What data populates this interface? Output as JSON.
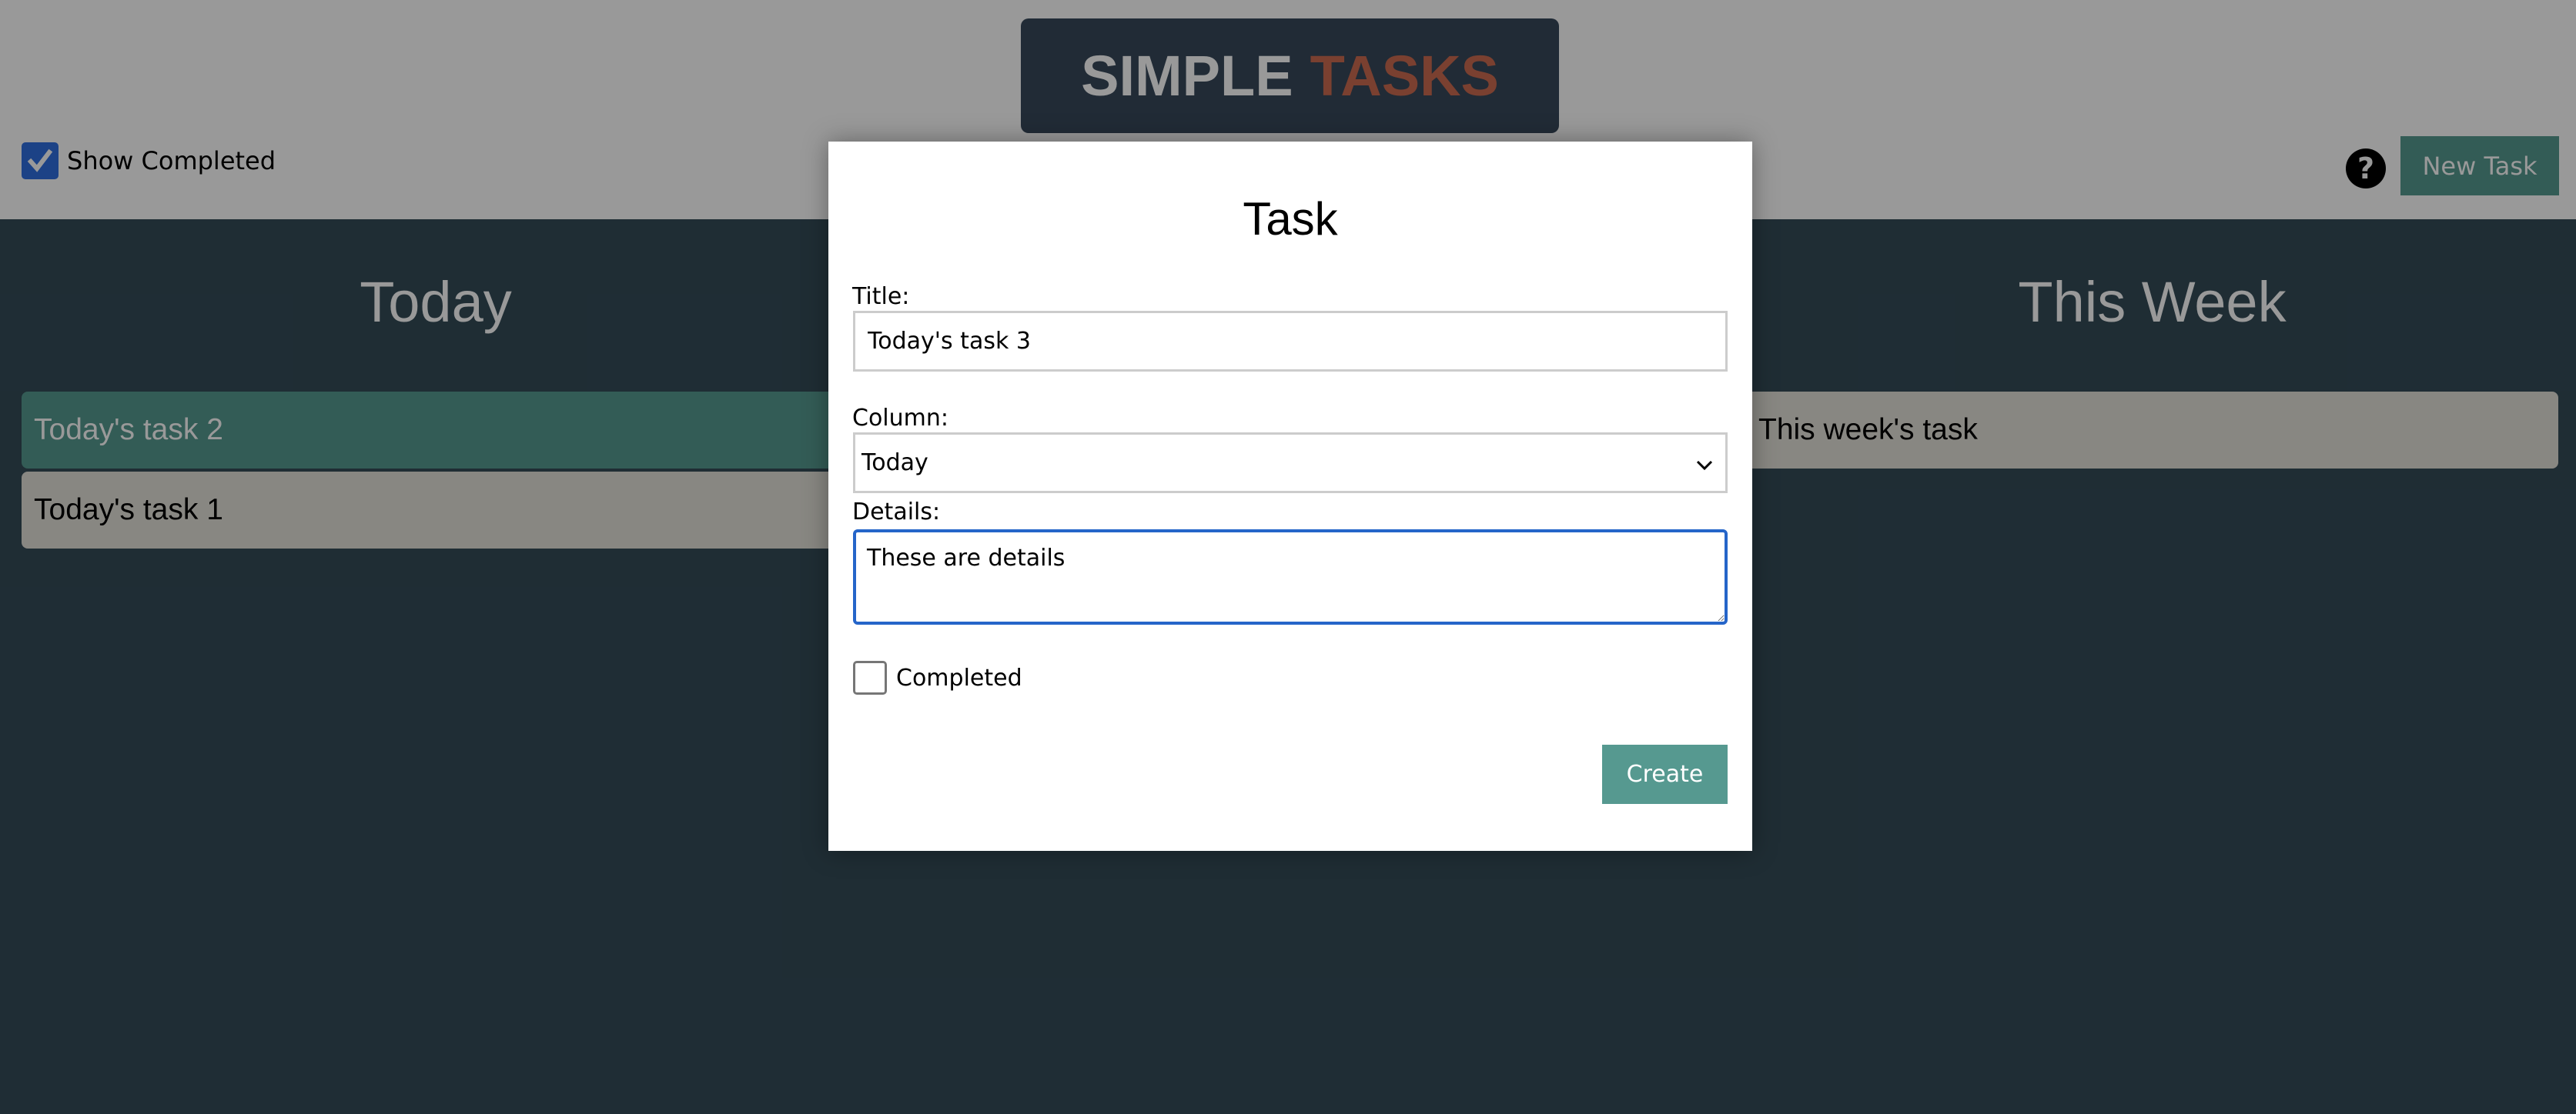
{
  "header": {
    "logo": {
      "word1": "SIMPLE",
      "word2": "TASKS"
    },
    "show_completed": {
      "label": "Show Completed",
      "checked": true
    },
    "help_icon": "question-circle-icon",
    "new_task_label": "New Task"
  },
  "columns": [
    {
      "title": "Today",
      "tasks": [
        {
          "title": "Today's task 2",
          "completed": true
        },
        {
          "title": "Today's task 1",
          "completed": false
        }
      ]
    },
    {
      "title": "This Week",
      "tasks": [
        {
          "title": "This week's task",
          "completed": false
        }
      ]
    }
  ],
  "modal": {
    "title": "Task",
    "title_label": "Title:",
    "title_value": "Today's task 3",
    "column_label": "Column:",
    "column_value": "Today",
    "details_label": "Details:",
    "details_value": "These are details",
    "completed_label": "Completed",
    "completed_checked": false,
    "create_label": "Create"
  },
  "colors": {
    "accent": "#569990",
    "logo_highlight": "#cc6b50",
    "focus_ring": "#2565c9",
    "checkbox_checked": "#2f6fe0"
  }
}
